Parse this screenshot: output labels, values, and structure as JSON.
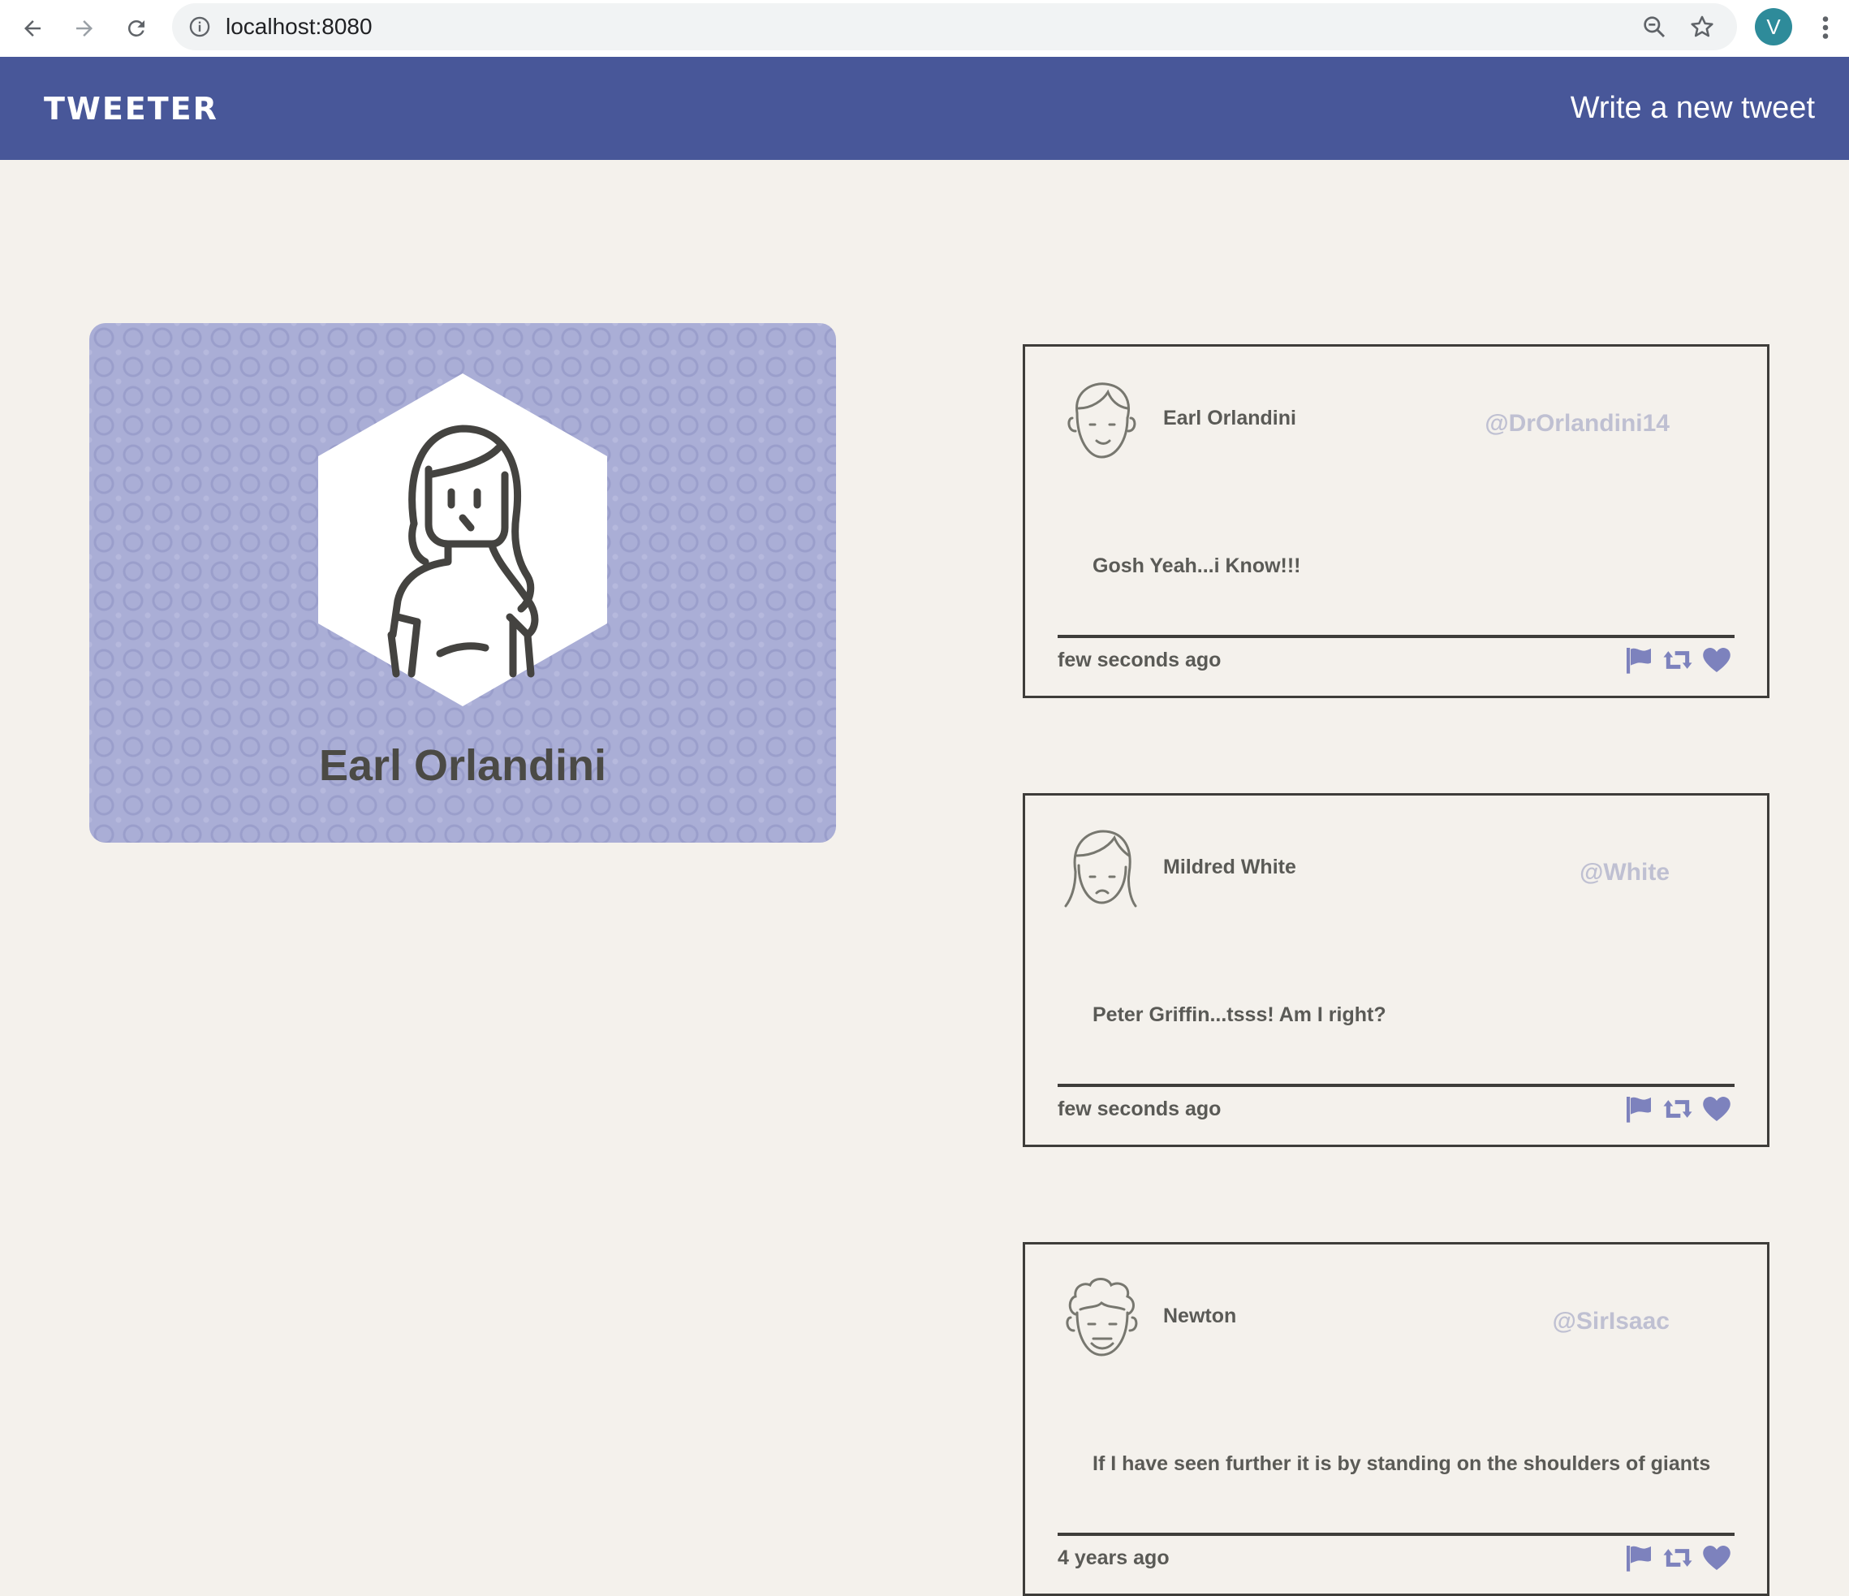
{
  "browser": {
    "url": "localhost:8080",
    "profile_initial": "V",
    "profile_color": "#2e8b9a"
  },
  "navbar": {
    "brand": "TWEETER",
    "compose_label": "Write a new tweet",
    "background": "#485799"
  },
  "profile": {
    "name": "Earl Orlandini",
    "avatar_icon": "woman-avatar-icon"
  },
  "tweets": [
    {
      "author": "Earl Orlandini",
      "handle": "@DrOrlandini14",
      "text": "Gosh Yeah...i Know!!!",
      "time": "few seconds ago",
      "avatar_icon": "man-avatar-icon"
    },
    {
      "author": "Mildred White",
      "handle": "@White",
      "text": "Peter Griffin...tsss! Am I right?",
      "time": "few seconds ago",
      "avatar_icon": "woman-avatar-icon"
    },
    {
      "author": "Newton",
      "handle": "@SirIsaac",
      "text": "If I have seen further it is by standing on the shoulders of giants",
      "time": "4 years ago",
      "avatar_icon": "curly-hair-man-avatar-icon"
    }
  ],
  "action_icons": [
    "flag-icon",
    "retweet-icon",
    "heart-icon"
  ],
  "action_color": "#7d82bd"
}
